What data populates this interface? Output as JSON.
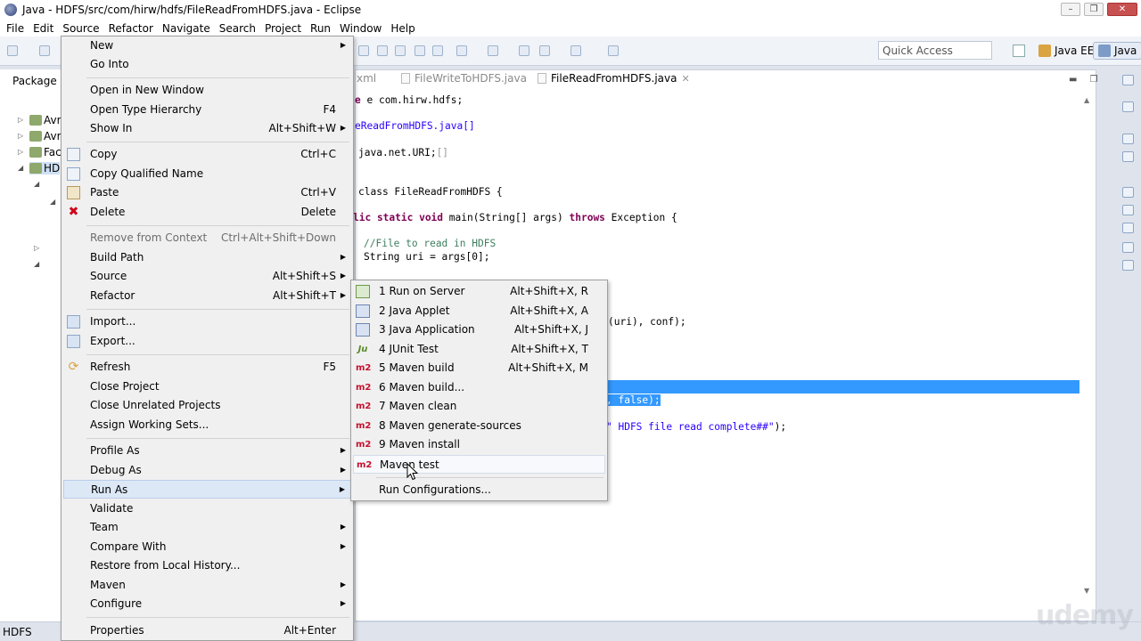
{
  "window": {
    "title": "Java - HDFS/src/com/hirw/hdfs/FileReadFromHDFS.java - Eclipse"
  },
  "menubar": [
    "File",
    "Edit",
    "Source",
    "Refactor",
    "Navigate",
    "Search",
    "Project",
    "Run",
    "Window",
    "Help"
  ],
  "toolbar": {
    "quick_access_placeholder": "Quick Access",
    "perspective_javaee": "Java EE",
    "perspective_java": "Java"
  },
  "package_explorer": {
    "tab_label": "Package",
    "items": [
      "Avr",
      "Avr",
      "Fac",
      "HD"
    ]
  },
  "editor": {
    "tabs": [
      {
        "label": "xml"
      },
      {
        "label": "FileWriteToHDFS.java"
      },
      {
        "label": "FileReadFromHDFS.java"
      }
    ],
    "code": {
      "l1": "e com.hirw.hdfs;",
      "l2": "eReadFromHDFS.java",
      "l3": "java.net.URI;",
      "l4": "class FileReadFromHDFS {",
      "l5a": "lic static void ",
      "l5b": "main(String[] args) ",
      "l5c": "throws",
      "l5d": " Exception {",
      "l6": "//File to read in HDFS",
      "l7": "String uri = args[0];",
      "l8": "(uri), conf);",
      "l9": ", false);",
      "l10a": "\" HDFS file read complete##\"",
      "l10b": ");"
    }
  },
  "context_menu": {
    "items": [
      {
        "label": "New"
      },
      {
        "label": "Go Into"
      },
      {
        "label": "Open in New Window"
      },
      {
        "label": "Open Type Hierarchy",
        "shortcut": "F4"
      },
      {
        "label": "Show In",
        "shortcut": "Alt+Shift+W"
      },
      {
        "label": "Copy",
        "shortcut": "Ctrl+C"
      },
      {
        "label": "Copy Qualified Name"
      },
      {
        "label": "Paste",
        "shortcut": "Ctrl+V"
      },
      {
        "label": "Delete",
        "shortcut": "Delete"
      },
      {
        "label": "Remove from Context",
        "shortcut": "Ctrl+Alt+Shift+Down"
      },
      {
        "label": "Build Path"
      },
      {
        "label": "Source",
        "shortcut": "Alt+Shift+S"
      },
      {
        "label": "Refactor",
        "shortcut": "Alt+Shift+T"
      },
      {
        "label": "Import..."
      },
      {
        "label": "Export..."
      },
      {
        "label": "Refresh",
        "shortcut": "F5"
      },
      {
        "label": "Close Project"
      },
      {
        "label": "Close Unrelated Projects"
      },
      {
        "label": "Assign Working Sets..."
      },
      {
        "label": "Profile As"
      },
      {
        "label": "Debug As"
      },
      {
        "label": "Run As"
      },
      {
        "label": "Validate"
      },
      {
        "label": "Team"
      },
      {
        "label": "Compare With"
      },
      {
        "label": "Restore from Local History..."
      },
      {
        "label": "Maven"
      },
      {
        "label": "Configure"
      },
      {
        "label": "Properties",
        "shortcut": "Alt+Enter"
      }
    ]
  },
  "run_as_submenu": {
    "items": [
      {
        "icon": "",
        "label": "1 Run on Server",
        "shortcut": "Alt+Shift+X, R"
      },
      {
        "icon": "",
        "label": "2 Java Applet",
        "shortcut": "Alt+Shift+X, A"
      },
      {
        "icon": "",
        "label": "3 Java Application",
        "shortcut": "Alt+Shift+X, J"
      },
      {
        "icon": "Ju",
        "label": "4 JUnit Test",
        "shortcut": "Alt+Shift+X, T"
      },
      {
        "icon": "m2",
        "label": "5 Maven build",
        "shortcut": "Alt+Shift+X, M"
      },
      {
        "icon": "m2",
        "label": "6 Maven build..."
      },
      {
        "icon": "m2",
        "label": "7 Maven clean"
      },
      {
        "icon": "m2",
        "label": "8 Maven generate-sources"
      },
      {
        "icon": "m2",
        "label": "9 Maven install"
      },
      {
        "icon": "m2",
        "label": "Maven test"
      },
      {
        "label": "Run Configurations..."
      }
    ]
  },
  "statusbar": {
    "text": "HDFS"
  },
  "watermark": "udemy"
}
